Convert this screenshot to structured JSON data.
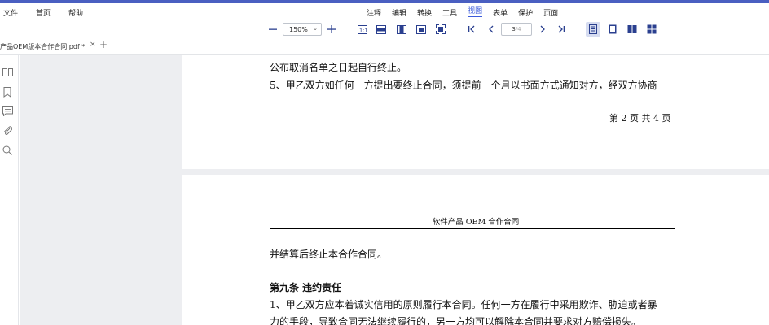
{
  "menu": {
    "file": "文件",
    "home": "首页",
    "help": "帮助",
    "tabs": [
      "注释",
      "编辑",
      "转换",
      "工具",
      "视图",
      "表单",
      "保护",
      "页面"
    ],
    "active_tab": "视图"
  },
  "toolbar": {
    "zoom_value": "150%",
    "page_current": "3",
    "page_total": "/4"
  },
  "doc_tabs": {
    "title": "产品OEM版本合作合同.pdf *"
  },
  "document": {
    "page1": {
      "line1": "公布取消名单之日起自行终止。",
      "line2": "5、甲乙双方如任何一方提出要终止合同，须提前一个月以书面方式通知对方，经双方协商",
      "page_number": "第 2 页 共 4 页"
    },
    "page2": {
      "header": "软件产品 OEM 合作合同",
      "line1": "并结算后终止本合作合同。",
      "heading": "第九条  违约责任",
      "line2": "1、甲乙双方应本着诚实信用的原则履行本合同。任何一方在履行中采用欺诈、胁迫或者暴",
      "line3": "力的手段，导致合同无法继续履行的，另一方均可以解除本合同并要求对方赔偿损失。"
    }
  },
  "colors": {
    "accent": "#3b5bdb",
    "topbar": "#4a5fc1",
    "icon": "#2a3f8f",
    "canvas": "#edeef1"
  }
}
